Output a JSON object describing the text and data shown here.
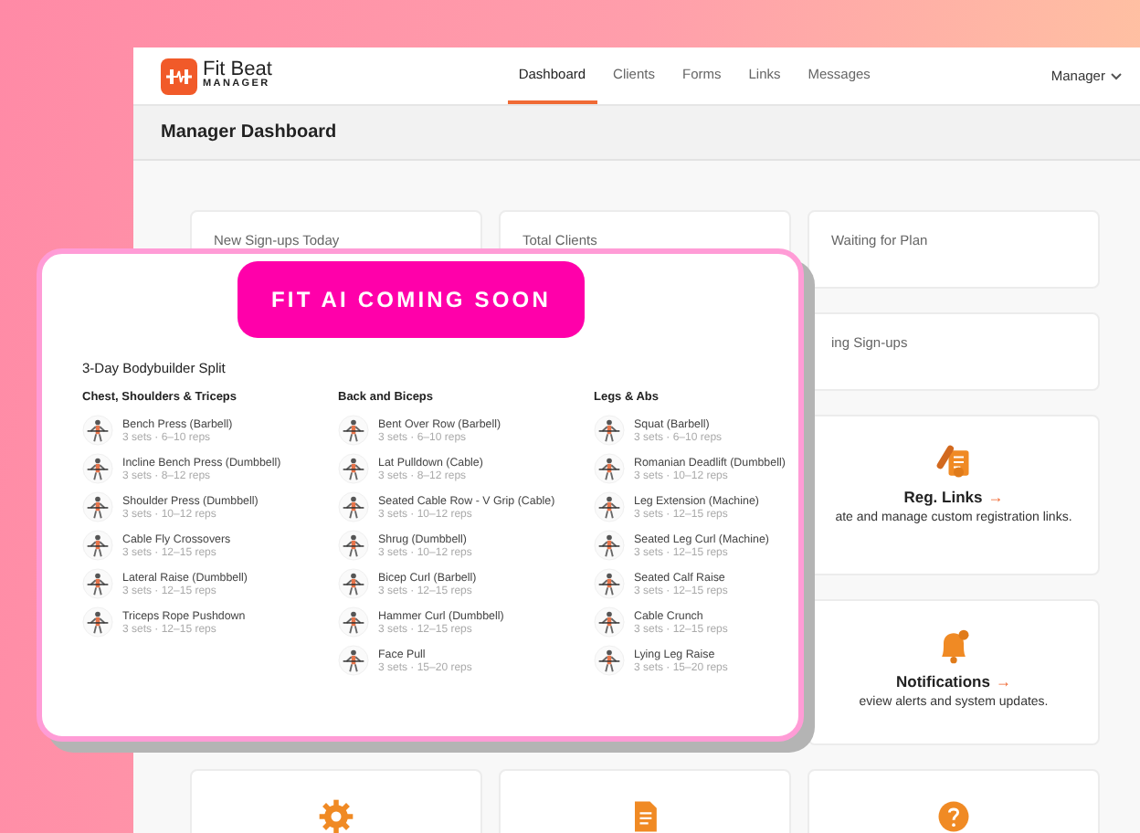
{
  "header": {
    "logo": {
      "name": "Fit Beat",
      "subtitle": "MANAGER"
    },
    "nav": [
      {
        "label": "Dashboard",
        "selected": true
      },
      {
        "label": "Clients",
        "selected": false
      },
      {
        "label": "Forms",
        "selected": false
      },
      {
        "label": "Links",
        "selected": false
      },
      {
        "label": "Messages",
        "selected": false
      }
    ],
    "user_menu": "Manager"
  },
  "page_title": "Manager Dashboard",
  "stats_row_1": [
    "New Sign-ups Today",
    "Total Clients",
    "Waiting for Plan"
  ],
  "stats_row_2": [
    "ing Sign-ups"
  ],
  "tiles": [
    {
      "kind": "links",
      "title": "Reg. Links",
      "arrow": "→",
      "description": "ate and manage custom registration links."
    },
    {
      "kind": "bell",
      "title": "Notifications",
      "arrow": "→",
      "description": "eview alerts and system updates."
    }
  ],
  "bottom_tiles": [
    {
      "kind": "gear"
    },
    {
      "kind": "document"
    },
    {
      "kind": "question"
    }
  ],
  "overlay": {
    "badge": "FIT AI COMING SOON",
    "plan_title": "3-Day Bodybuilder Split",
    "days": [
      {
        "title": "Chest, Shoulders & Triceps",
        "exercises": [
          {
            "name": "Bench Press (Barbell)",
            "detail": "3 sets · 6–10 reps"
          },
          {
            "name": "Incline Bench Press (Dumbbell)",
            "detail": "3 sets · 8–12 reps"
          },
          {
            "name": "Shoulder Press (Dumbbell)",
            "detail": "3 sets · 10–12 reps"
          },
          {
            "name": "Cable Fly Crossovers",
            "detail": "3 sets · 12–15 reps"
          },
          {
            "name": "Lateral Raise (Dumbbell)",
            "detail": "3 sets · 12–15 reps"
          },
          {
            "name": "Triceps Rope Pushdown",
            "detail": "3 sets · 12–15 reps"
          }
        ]
      },
      {
        "title": "Back and Biceps",
        "exercises": [
          {
            "name": "Bent Over Row (Barbell)",
            "detail": "3 sets · 6–10 reps"
          },
          {
            "name": "Lat Pulldown (Cable)",
            "detail": "3 sets · 8–12 reps"
          },
          {
            "name": "Seated Cable Row - V Grip (Cable)",
            "detail": "3 sets · 10–12 reps"
          },
          {
            "name": "Shrug (Dumbbell)",
            "detail": "3 sets · 10–12 reps"
          },
          {
            "name": "Bicep Curl (Barbell)",
            "detail": "3 sets · 12–15 reps"
          },
          {
            "name": "Hammer Curl (Dumbbell)",
            "detail": "3 sets · 12–15 reps"
          },
          {
            "name": "Face Pull",
            "detail": "3 sets · 15–20 reps"
          }
        ]
      },
      {
        "title": "Legs & Abs",
        "exercises": [
          {
            "name": "Squat (Barbell)",
            "detail": "3 sets · 6–10 reps"
          },
          {
            "name": "Romanian Deadlift (Dumbbell)",
            "detail": "3 sets · 10–12 reps"
          },
          {
            "name": "Leg Extension (Machine)",
            "detail": "3 sets · 12–15 reps"
          },
          {
            "name": "Seated Leg Curl (Machine)",
            "detail": "3 sets · 12–15 reps"
          },
          {
            "name": "Seated Calf Raise",
            "detail": "3 sets · 12–15 reps"
          },
          {
            "name": "Cable Crunch",
            "detail": "3 sets · 12–15 reps"
          },
          {
            "name": "Lying Leg Raise",
            "detail": "3 sets · 15–20 reps"
          }
        ]
      }
    ]
  }
}
